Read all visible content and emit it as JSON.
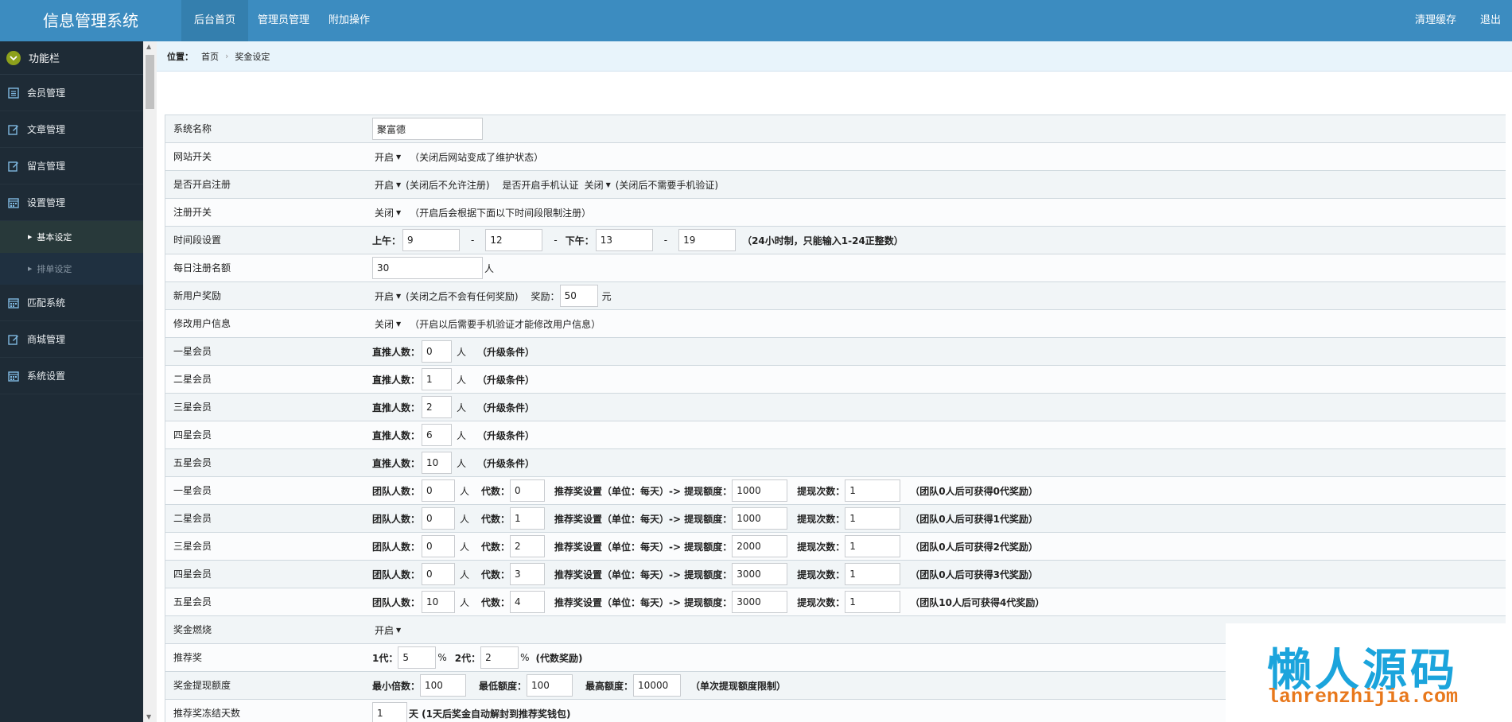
{
  "header": {
    "app_title": "信息管理系统",
    "nav": [
      "后台首页",
      "管理员管理",
      "附加操作"
    ],
    "right": [
      "清理缓存",
      "退出"
    ]
  },
  "sidebar": {
    "title": "功能栏",
    "items": [
      {
        "label": "会员管理",
        "icon": "list-icon"
      },
      {
        "label": "文章管理",
        "icon": "edit-icon"
      },
      {
        "label": "留言管理",
        "icon": "edit-icon"
      },
      {
        "label": "设置管理",
        "icon": "calendar-icon"
      },
      {
        "label": "匹配系统",
        "icon": "calendar-icon"
      },
      {
        "label": "商城管理",
        "icon": "edit-icon"
      },
      {
        "label": "系统设置",
        "icon": "calendar-icon"
      }
    ],
    "subitems": [
      "基本设定",
      "排单设定"
    ]
  },
  "breadcrumb": {
    "label": "位置：",
    "home": "首页",
    "current": "奖金设定"
  },
  "form": {
    "r1": {
      "label": "系统名称",
      "value": "聚富德"
    },
    "r2": {
      "label": "网站开关",
      "select": "开启",
      "note": "（关闭后网站变成了维护状态）"
    },
    "r3": {
      "label": "是否开启注册",
      "select": "开启",
      "note": "(关闭后不允许注册)",
      "label2": "是否开启手机认证",
      "select2": "关闭",
      "note2": "(关闭后不需要手机验证)"
    },
    "r4": {
      "label": "注册开关",
      "select": "关闭",
      "note": "（开启后会根据下面以下时间段限制注册）"
    },
    "r5": {
      "label": "时间段设置",
      "am": "上午：",
      "v1": "9",
      "dash": "-",
      "v2": "12",
      "pm": "下午：",
      "v3": "13",
      "v4": "19",
      "note": "（24小时制，只能输入1-24正整数）"
    },
    "r6": {
      "label": "每日注册名额",
      "value": "30",
      "unit": "人"
    },
    "r7": {
      "label": "新用户奖励",
      "select": "开启",
      "note": "(关闭之后不会有任何奖励)",
      "reward_label": "奖励：",
      "reward": "50",
      "unit": "元"
    },
    "r8": {
      "label": "修改用户信息",
      "select": "关闭",
      "note": "（开启以后需要手机验证才能修改用户信息）"
    },
    "star_direct": {
      "field": "直推人数：",
      "unit": "人",
      "note": "（升级条件）",
      "rows": [
        {
          "label": "一星会员",
          "value": "0"
        },
        {
          "label": "二星会员",
          "value": "1"
        },
        {
          "label": "三星会员",
          "value": "2"
        },
        {
          "label": "四星会员",
          "value": "6"
        },
        {
          "label": "五星会员",
          "value": "10"
        }
      ]
    },
    "star_team": {
      "team_field": "团队人数：",
      "unit": "人",
      "gen_field": "代数：",
      "rec_field": "推荐奖设置（单位：每天）-> 提现额度：",
      "times_field": "提现次数：",
      "rows": [
        {
          "label": "一星会员",
          "team": "0",
          "gen": "0",
          "limit": "1000",
          "times": "1",
          "note": "（团队0人后可获得0代奖励）"
        },
        {
          "label": "二星会员",
          "team": "0",
          "gen": "1",
          "limit": "1000",
          "times": "1",
          "note": "（团队0人后可获得1代奖励）"
        },
        {
          "label": "三星会员",
          "team": "0",
          "gen": "2",
          "limit": "2000",
          "times": "1",
          "note": "（团队0人后可获得2代奖励）"
        },
        {
          "label": "四星会员",
          "team": "0",
          "gen": "3",
          "limit": "3000",
          "times": "1",
          "note": "（团队0人后可获得3代奖励）"
        },
        {
          "label": "五星会员",
          "team": "10",
          "gen": "4",
          "limit": "3000",
          "times": "1",
          "note": "（团队10人后可获得4代奖励）"
        }
      ]
    },
    "burn": {
      "label": "奖金燃烧",
      "select": "开启"
    },
    "rec": {
      "label": "推荐奖",
      "g1": "1代：",
      "v1": "5",
      "pct": "%",
      "g2": "2代：",
      "v2": "2",
      "note": "(代数奖励)"
    },
    "withdraw": {
      "label": "奖金提现额度",
      "f1": "最小倍数：",
      "v1": "100",
      "f2": "最低额度：",
      "v2": "100",
      "f3": "最高额度：",
      "v3": "10000",
      "note": "（单次提现额度限制）"
    },
    "freeze": {
      "label": "推荐奖冻结天数",
      "value": "1",
      "note": "天 (1天后奖金自动解封到推荐奖钱包)"
    }
  },
  "watermark": {
    "title": "懒人源码",
    "url": "lanrenzhijia.com"
  }
}
